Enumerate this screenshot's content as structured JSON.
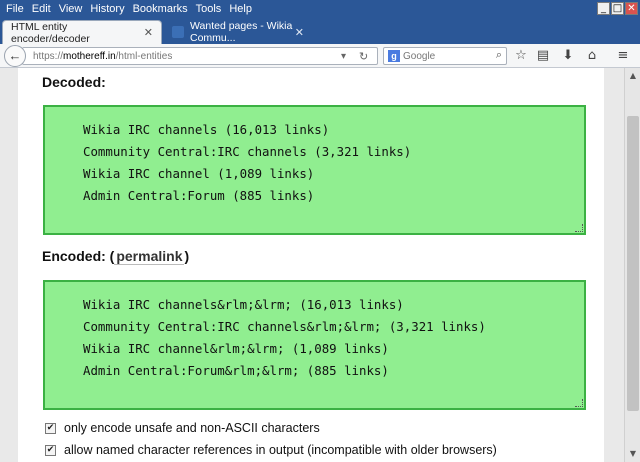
{
  "menu": [
    "File",
    "Edit",
    "View",
    "History",
    "Bookmarks",
    "Tools",
    "Help"
  ],
  "window_controls": {
    "minimize": "_",
    "maximize": "□",
    "close": "✕"
  },
  "tabs": [
    {
      "label": "HTML entity encoder/decoder",
      "active": true
    },
    {
      "label": "Wanted pages - Wikia Commu...",
      "active": false
    }
  ],
  "newtab_label": "+",
  "navbar": {
    "url_scheme": "https://",
    "url_host": "mothereff.in",
    "url_path": "/html-entities",
    "search_placeholder": "Google",
    "icons": [
      "back-icon",
      "star-icon",
      "reading-list-icon",
      "download-icon",
      "home-icon",
      "menu-icon"
    ]
  },
  "decoded": {
    "heading": "Decoded:",
    "lines": [
      "Wikia IRC channels (16,013 links)",
      "Community Central:IRC channels (3,321 links)",
      "Wikia IRC channel (1,089 links)",
      "Admin Central:Forum (885 links)"
    ]
  },
  "encoded": {
    "heading": "Encoded:",
    "paren_open": "(",
    "permalink": "permalink",
    "paren_close": ")",
    "lines": [
      "Wikia IRC channels&rlm;&lrm; (16,013 links)",
      "Community Central:IRC channels&rlm;&lrm; (3,321 links)",
      "Wikia IRC channel&rlm;&lrm; (1,089 links)",
      "Admin Central:Forum&rlm;&lrm; (885 links)"
    ]
  },
  "options": [
    {
      "label": "only encode unsafe and non-ASCII characters",
      "checked": true
    },
    {
      "label": "allow named character references in output (incompatible with older browsers)",
      "checked": true
    }
  ],
  "colors": {
    "codebox_bg": "#90ee90",
    "codebox_border": "#3bb143",
    "chrome": "#2b5797"
  }
}
